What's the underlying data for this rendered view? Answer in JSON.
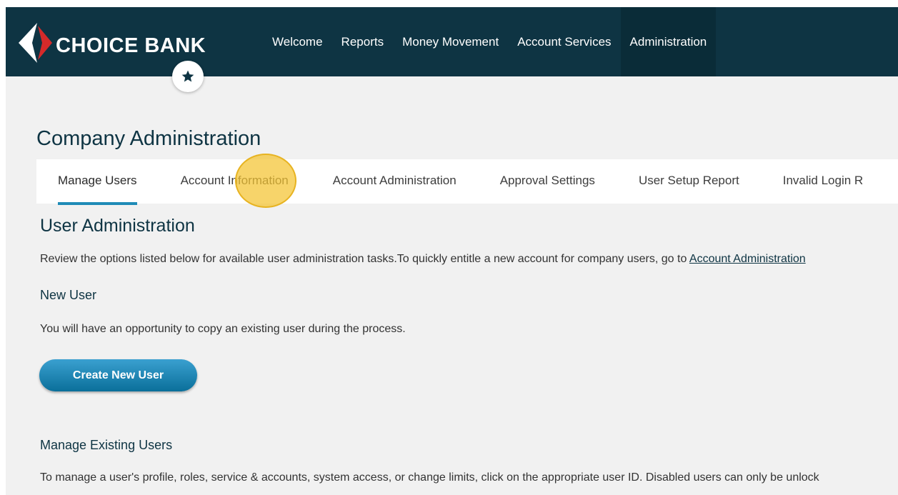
{
  "brand": {
    "name": "CHOICE BANK"
  },
  "nav": {
    "items": [
      {
        "label": "Welcome"
      },
      {
        "label": "Reports"
      },
      {
        "label": "Money Movement"
      },
      {
        "label": "Account Services"
      },
      {
        "label": "Administration"
      }
    ],
    "active_label": "Administration"
  },
  "page": {
    "title": "Company Administration"
  },
  "tabs": [
    {
      "label": "Manage Users",
      "active": true
    },
    {
      "label": "Account Information"
    },
    {
      "label": "Account Administration"
    },
    {
      "label": "Approval Settings"
    },
    {
      "label": "User Setup Report"
    },
    {
      "label": "Invalid Login R"
    }
  ],
  "user_admin": {
    "title": "User Administration",
    "intro": "Review the options listed below for available user administration tasks.To quickly entitle a new account for company users, go to",
    "intro_link": "Account Administration",
    "new_user_heading": "New User",
    "new_user_text": "You will have an opportunity to copy an existing user during the process.",
    "create_button": "Create New User",
    "manage_heading": "Manage Existing Users",
    "manage_text": "To manage a user's profile, roles, service & accounts, system access, or change limits, click on the appropriate user ID. Disabled users can only be unlock"
  },
  "icons": {
    "favorite": "star-icon",
    "logo_mark": "arrow-logo-icon"
  },
  "colors": {
    "header_bg": "#0e3443",
    "accent": "#1f8bb7",
    "logo_red": "#d42a2a",
    "click_highlight": "#f4c430"
  }
}
